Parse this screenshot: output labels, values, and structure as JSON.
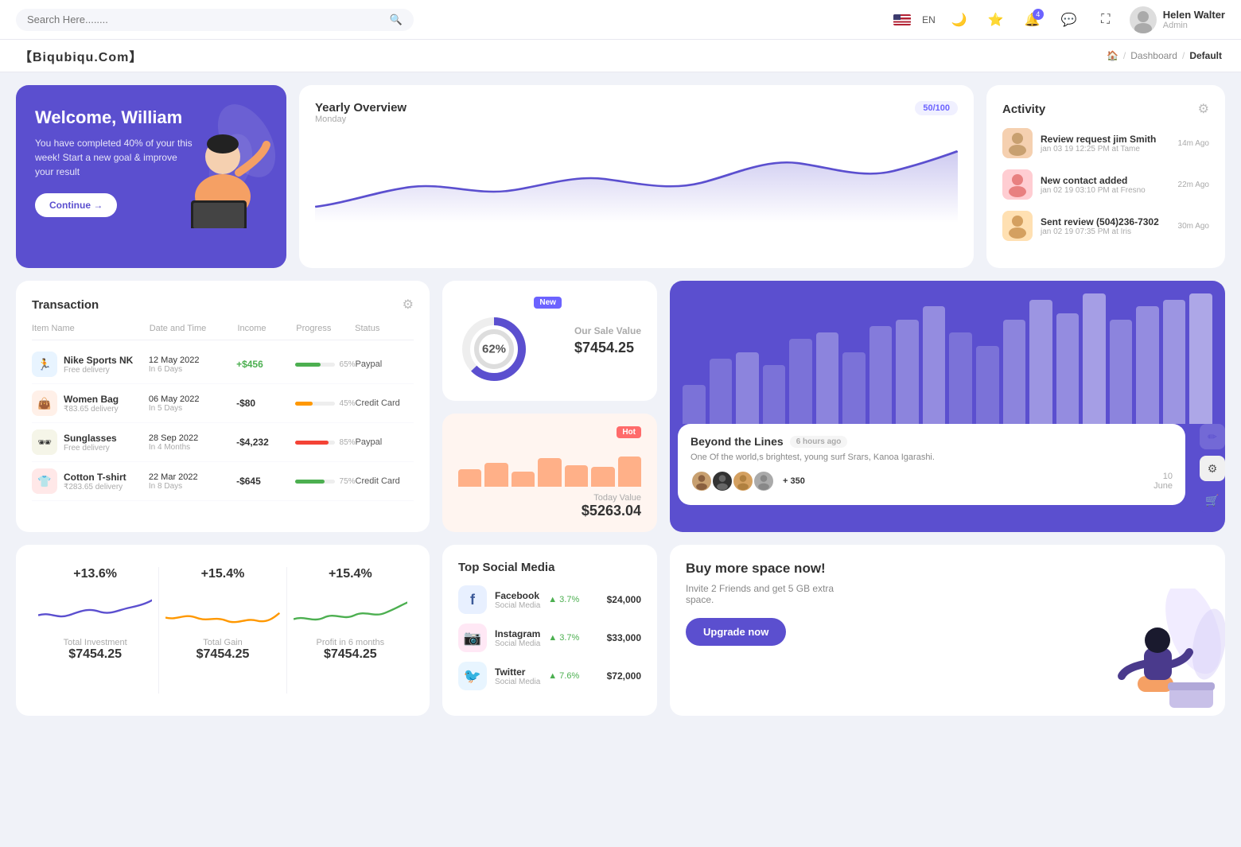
{
  "topnav": {
    "search_placeholder": "Search Here........",
    "lang": "EN",
    "user_name": "Helen Walter",
    "user_role": "Admin",
    "notif_count": "4"
  },
  "breadcrumb": {
    "brand": "【Biqubiqu.Com】",
    "home": "🏠",
    "sep1": "/",
    "dashboard": "Dashboard",
    "sep2": "/",
    "current": "Default"
  },
  "welcome": {
    "title": "Welcome, William",
    "subtitle": "You have completed 40% of your this week! Start a new goal & improve your result",
    "btn": "Continue →"
  },
  "yearly": {
    "title": "Yearly Overview",
    "day": "Monday",
    "progress": "50/100"
  },
  "activity": {
    "title": "Activity",
    "items": [
      {
        "title": "Review request jim Smith",
        "sub": "jan 03 19 12:25 PM at Tame",
        "time": "14m Ago"
      },
      {
        "title": "New contact added",
        "sub": "jan 02 19 03:10 PM at Fresno",
        "time": "22m Ago"
      },
      {
        "title": "Sent review (504)236-7302",
        "sub": "jan 02 19 07:35 PM at Iris",
        "time": "30m Ago"
      }
    ]
  },
  "transaction": {
    "title": "Transaction",
    "headers": [
      "Item Name",
      "Date and Time",
      "Income",
      "Progress",
      "Status"
    ],
    "rows": [
      {
        "icon": "🏃",
        "icon_bg": "#e8f4ff",
        "name": "Nike Sports NK",
        "sub": "Free delivery",
        "date": "12 May 2022",
        "date_sub": "In 6 Days",
        "income": "+$456",
        "income_type": "pos",
        "progress": 65,
        "progress_color": "#4caf50",
        "status": "Paypal"
      },
      {
        "icon": "👜",
        "icon_bg": "#fff0e8",
        "name": "Women Bag",
        "sub": "₹83.65 delivery",
        "date": "06 May 2022",
        "date_sub": "In 5 Days",
        "income": "-$80",
        "income_type": "neg",
        "progress": 45,
        "progress_color": "#ff9800",
        "status": "Credit Card"
      },
      {
        "icon": "🕶",
        "icon_bg": "#f5f5e8",
        "name": "Sunglasses",
        "sub": "Free delivery",
        "date": "28 Sep 2022",
        "date_sub": "In 4 Months",
        "income": "-$4,232",
        "income_type": "neg",
        "progress": 85,
        "progress_color": "#f44336",
        "status": "Paypal"
      },
      {
        "icon": "👕",
        "icon_bg": "#ffe8e8",
        "name": "Cotton T-shirt",
        "sub": "₹283.65 delivery",
        "date": "22 Mar 2022",
        "date_sub": "In 8 Days",
        "income": "-$645",
        "income_type": "neg",
        "progress": 75,
        "progress_color": "#4caf50",
        "status": "Credit Card"
      }
    ]
  },
  "sale_value": {
    "badge": "New",
    "percent": "62%",
    "label": "Our Sale Value",
    "value": "$7454.25"
  },
  "today_value": {
    "badge": "Hot",
    "label": "Today Value",
    "value": "$5263.04",
    "bars": [
      40,
      55,
      35,
      65,
      50,
      45,
      70
    ]
  },
  "beyond": {
    "bars": [
      30,
      50,
      70,
      55,
      80,
      90,
      65,
      75,
      85,
      95,
      70,
      60,
      80,
      100,
      90,
      110,
      85,
      95,
      105,
      120
    ],
    "title": "Beyond the Lines",
    "time_ago": "6 hours ago",
    "desc": "One Of the world,s brightest, young surf Srars, Kanoa Igarashi.",
    "plus_count": "+ 350",
    "date_num": "10",
    "date_month": "June",
    "icons": [
      "✏",
      "⚙",
      "🛒"
    ]
  },
  "mini_stats": [
    {
      "pct": "+13.6%",
      "label": "Total Investment",
      "value": "$7454.25",
      "color": "#5b4fcf"
    },
    {
      "pct": "+15.4%",
      "label": "Total Gain",
      "value": "$7454.25",
      "color": "#ff9800"
    },
    {
      "pct": "+15.4%",
      "label": "Profit in 6 months",
      "value": "$7454.25",
      "color": "#4caf50"
    }
  ],
  "social": {
    "title": "Top Social Media",
    "items": [
      {
        "icon": "f",
        "icon_bg": "#e8f0ff",
        "icon_color": "#3b5998",
        "name": "Facebook",
        "type": "Social Media",
        "pct": "3.7%",
        "value": "$24,000"
      },
      {
        "icon": "📸",
        "icon_bg": "#ffe8f5",
        "icon_color": "#c13584",
        "name": "Instagram",
        "type": "Social Media",
        "pct": "3.7%",
        "value": "$33,000"
      },
      {
        "icon": "🐦",
        "icon_bg": "#e8f5ff",
        "icon_color": "#1da1f2",
        "name": "Twitter",
        "type": "Social Media",
        "pct": "7.6%",
        "value": "$72,000"
      }
    ]
  },
  "buyspace": {
    "title": "Buy more space now!",
    "desc": "Invite 2 Friends and get 5 GB extra space.",
    "btn": "Upgrade now"
  }
}
